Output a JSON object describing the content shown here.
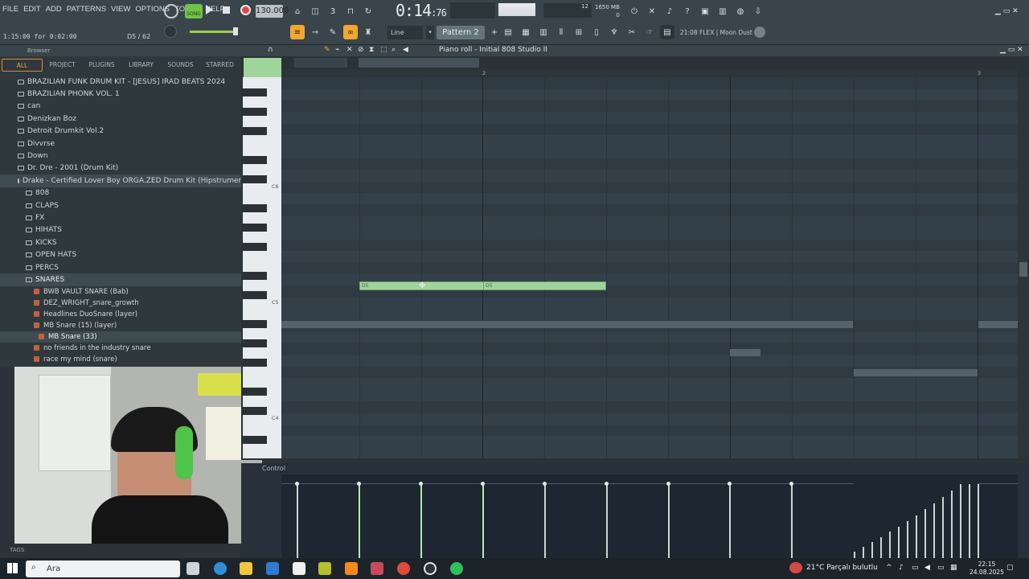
{
  "menu": {
    "items": [
      "FILE",
      "EDIT",
      "ADD",
      "PATTERNS",
      "VIEW",
      "OPTIONS",
      "TOOLS",
      "HELP"
    ]
  },
  "toolbar": {
    "hint": "1:15:00 for 0:02:00",
    "hint2": "D5 / 62",
    "song_label": "SONG",
    "tempo": "130.000",
    "time_main": "0:14",
    "time_sub": "76",
    "cpu": "12",
    "mem": "1650 MB",
    "mem2": "0",
    "snap": "Line",
    "pattern": "Pattern 2",
    "plugin_info": "21:08  FLEX | Moon Dust"
  },
  "browser": {
    "header": "Browser",
    "tabs": [
      "ALL",
      "PROJECT",
      "PLUGINS",
      "LIBRARY",
      "SOUNDS",
      "STARRED"
    ],
    "folders": [
      "BRAZILIAN FUNK DRUM KIT - [JESUS] IRAD BEATS 2024",
      "BRAZILIAN PHONK VOL. 1",
      "can",
      "Denizkan Boz",
      "Detroit Drumkit Vol.2",
      "Divvrse",
      "Down",
      "Dr. Dre - 2001 (Drum Kit)",
      "Drake - Certified Lover Boy ORGA.ZED Drum Kit (Hipstrumentals.com)"
    ],
    "subfolders": [
      "808",
      "CLAPS",
      "FX",
      "HIHATS",
      "KICKS",
      "OPEN HATS",
      "PERCS",
      "SNARES"
    ],
    "files": [
      "BWB VAULT SNARE (Bab)",
      "DEZ_WRIGHT_snare_growth",
      "Headlines DuoSnare (layer)",
      "MB Snare (15) (layer)",
      "MB Snare (33)",
      "no friends in the industry snare",
      "race my mind (snare)"
    ],
    "tags_label": "TAGS"
  },
  "piano_roll": {
    "title": "Piano roll - Initial 808 Studio II",
    "ruler": [
      "2",
      "3"
    ],
    "key_labels": [
      "C6",
      "C5",
      "C4"
    ],
    "note_label": "D5",
    "event_label": "Control"
  },
  "taskbar": {
    "search_placeholder": "Ara",
    "weather": "21°C  Parçalı bulutlu",
    "time": "22:15",
    "date": "24.08.2025"
  }
}
